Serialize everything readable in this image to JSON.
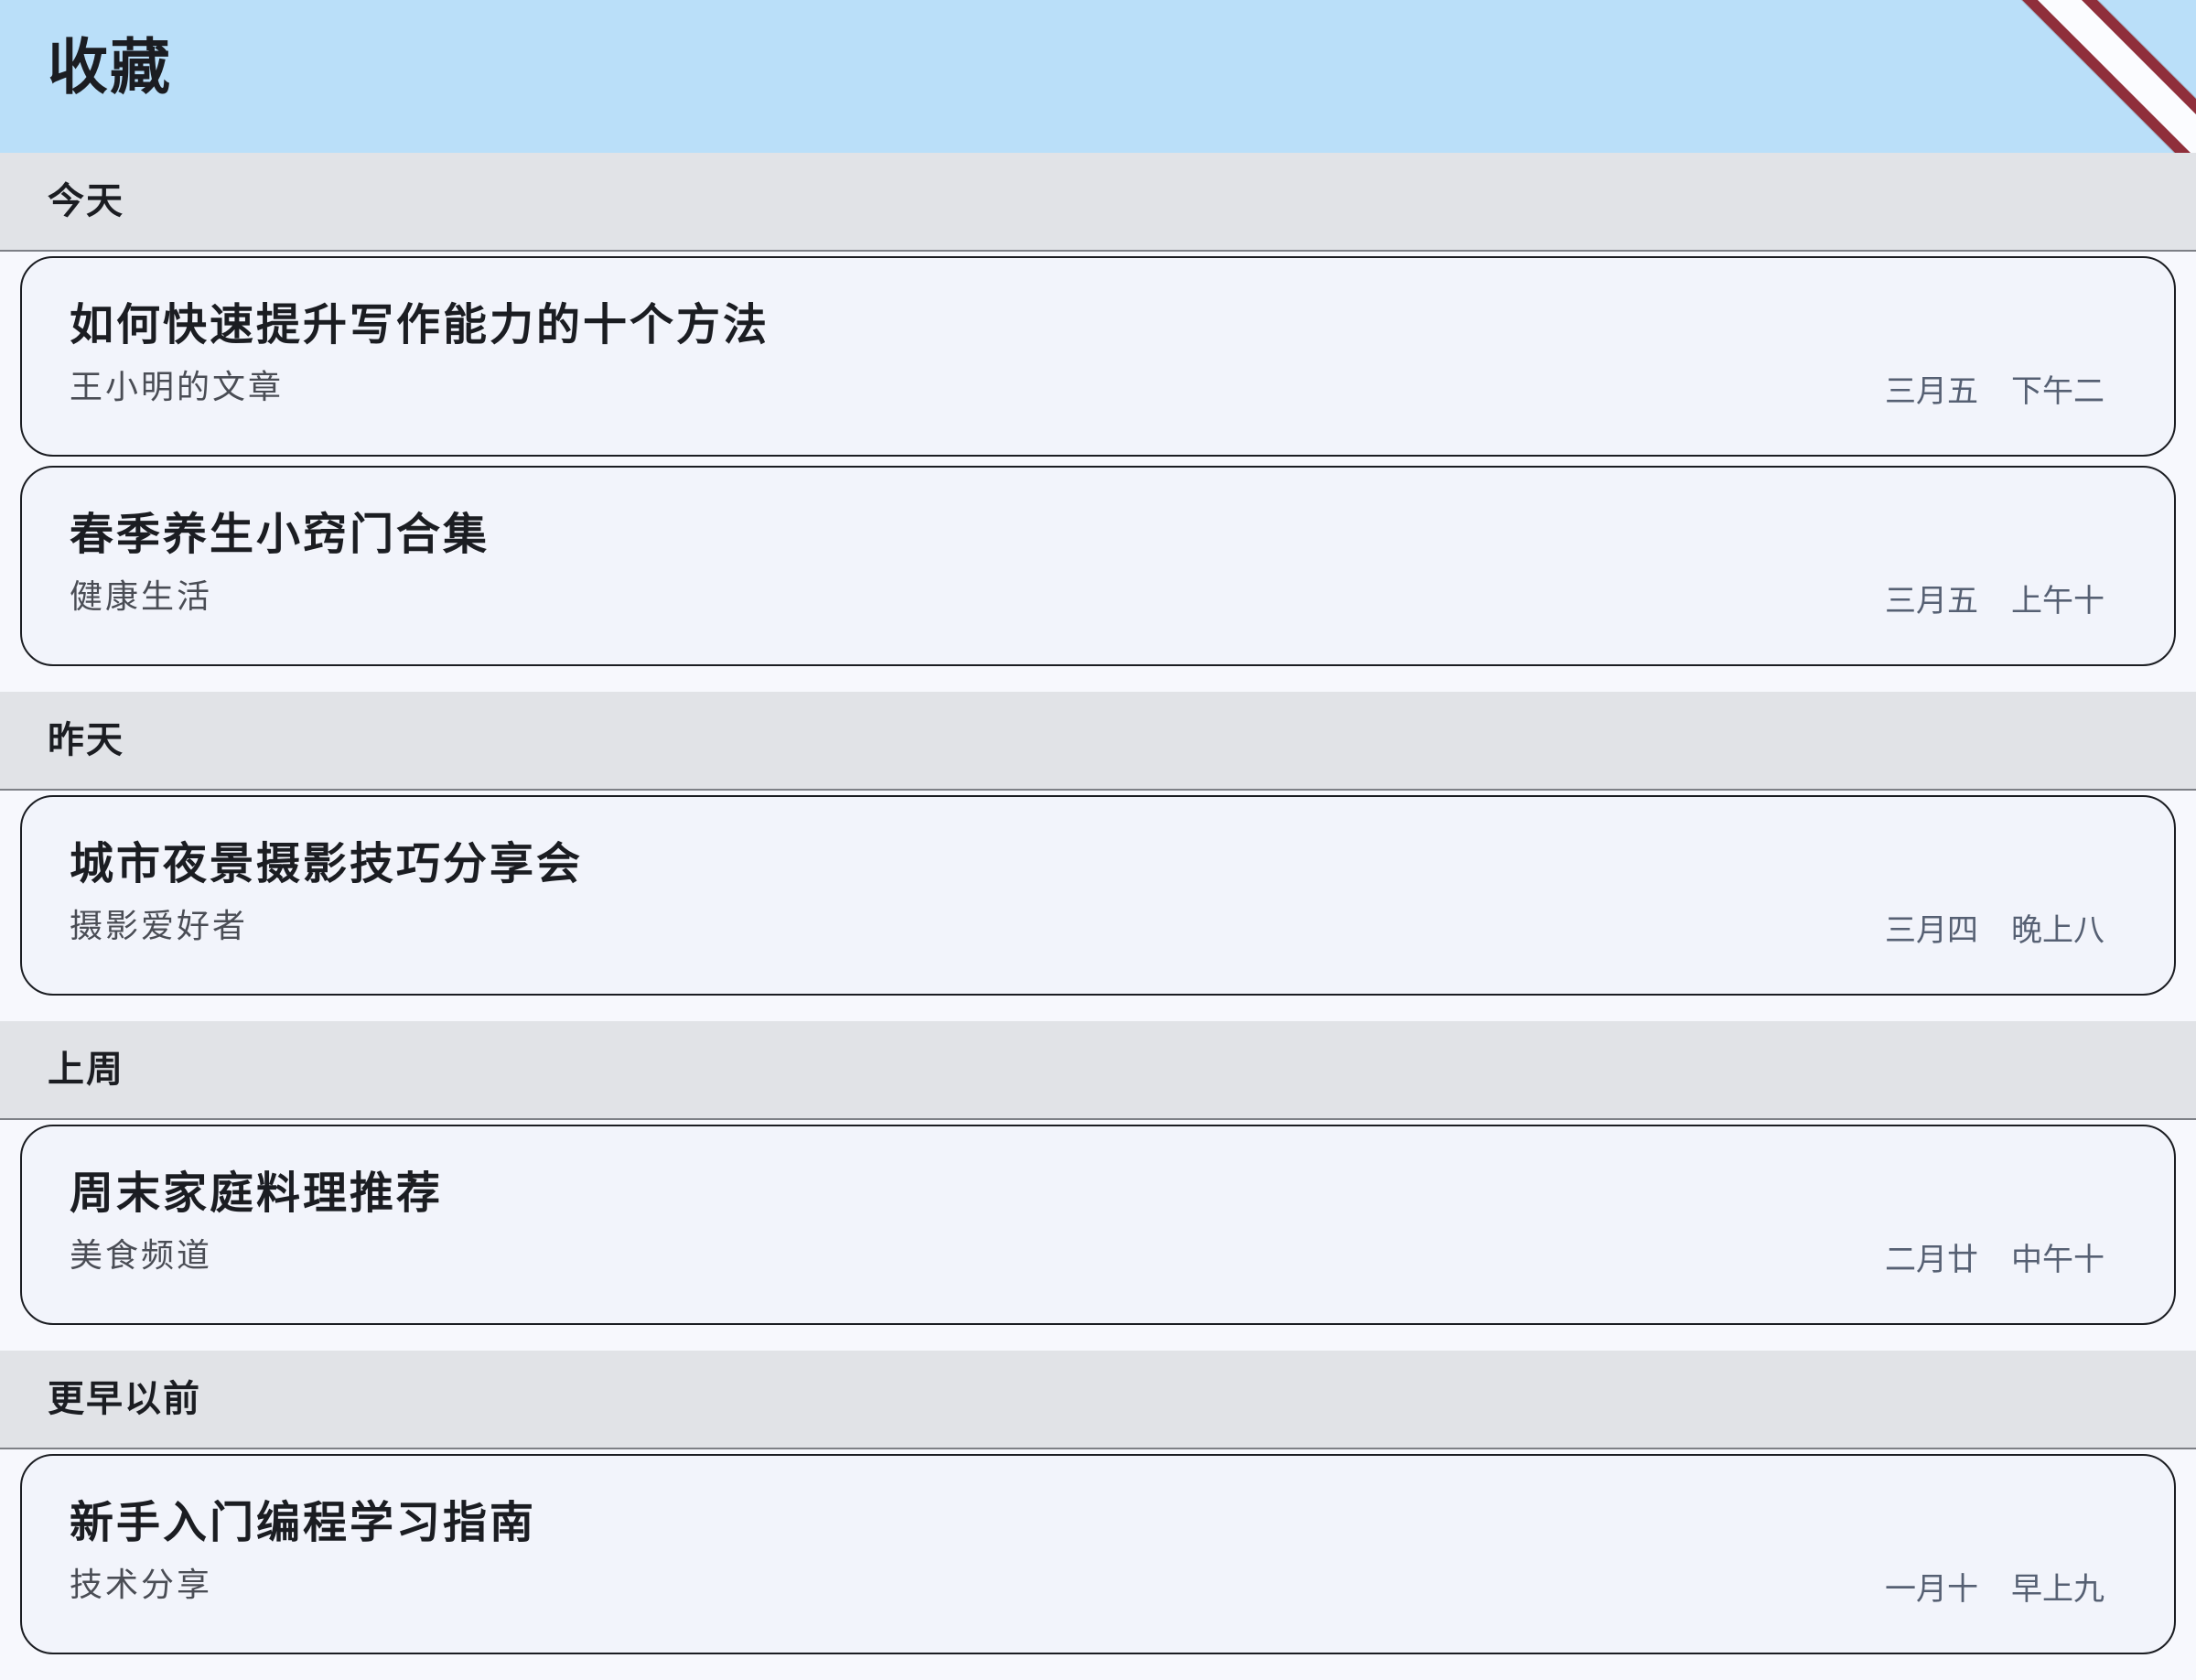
{
  "header": {
    "title": "收藏",
    "ribbon_label": ""
  },
  "sections": [
    {
      "label": "今天",
      "items": [
        {
          "title": "如何快速提升写作能力的十个方法",
          "subtitle": "王小明的文章",
          "date": "三月五",
          "time": "下午二"
        },
        {
          "title": "春季养生小窍门合集",
          "subtitle": "健康生活",
          "date": "三月五",
          "time": "上午十"
        }
      ]
    },
    {
      "label": "昨天",
      "items": [
        {
          "title": "城市夜景摄影技巧分享会",
          "subtitle": "摄影爱好者",
          "date": "三月四",
          "time": "晚上八"
        }
      ]
    },
    {
      "label": "上周",
      "items": [
        {
          "title": "周末家庭料理推荐",
          "subtitle": "美食频道",
          "date": "二月廿",
          "time": "中午十"
        }
      ]
    },
    {
      "label": "更早以前",
      "items": [
        {
          "title": "新手入门编程学习指南",
          "subtitle": "技术分享",
          "date": "一月十",
          "time": "早上九"
        }
      ]
    }
  ]
}
